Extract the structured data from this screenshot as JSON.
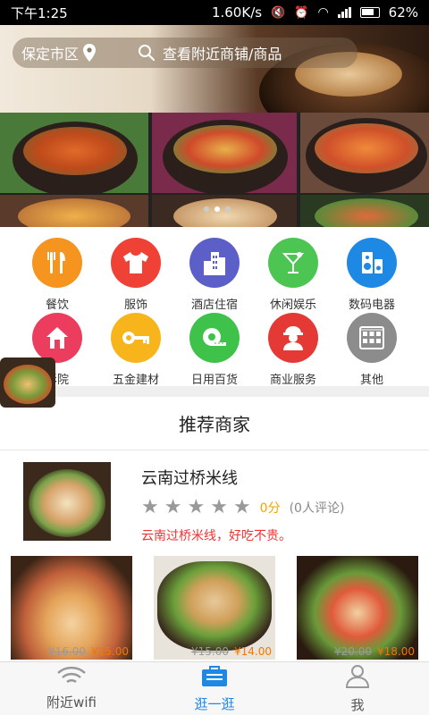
{
  "status_bar": {
    "time": "下午1:25",
    "network_speed": "1.60K/s",
    "battery": "62%"
  },
  "search": {
    "location": "保定市区",
    "placeholder": "查看附近商铺/商品",
    "location_icon": "location-pin-icon",
    "search_icon": "magnifier-icon"
  },
  "carousel": {
    "page_count": 3,
    "active_page": 1
  },
  "categories": [
    {
      "label": "餐饮",
      "icon": "fork-knife-icon",
      "color": "#f5941e"
    },
    {
      "label": "服饰",
      "icon": "shirt-icon",
      "color": "#ef4135"
    },
    {
      "label": "酒店住宿",
      "icon": "building-icon",
      "color": "#5b5fc7"
    },
    {
      "label": "休闲娱乐",
      "icon": "cocktail-icon",
      "color": "#4cc552"
    },
    {
      "label": "数码电器",
      "icon": "speaker-icon",
      "color": "#1e88e5"
    },
    {
      "label": "影院",
      "icon": "house-icon",
      "color": "#ec3d5e"
    },
    {
      "label": "五金建材",
      "icon": "key-icon",
      "color": "#f7b51b"
    },
    {
      "label": "日用百货",
      "icon": "tape-measure-icon",
      "color": "#3ec24a"
    },
    {
      "label": "商业服务",
      "icon": "person-icon",
      "color": "#e53935"
    },
    {
      "label": "其他",
      "icon": "grid-icon",
      "color": "#8c8c8c"
    }
  ],
  "recommended": {
    "title": "推荐商家"
  },
  "merchant": {
    "name": "云南过桥米线",
    "rating": 0,
    "score_text": "0分",
    "reviews_text": "(0人评论)",
    "description": "云南过桥米线，好吃不贵。"
  },
  "products": [
    {
      "old_price": "¥16.00",
      "new_price": "¥15.00"
    },
    {
      "old_price": "¥15.00",
      "new_price": "¥14.00"
    },
    {
      "old_price": "¥20.00",
      "new_price": "¥18.00"
    }
  ],
  "tabs": [
    {
      "label": "附近wifi",
      "icon": "wifi-icon",
      "active": false
    },
    {
      "label": "逛一逛",
      "icon": "shopping-bag-icon",
      "active": true
    },
    {
      "label": "我",
      "icon": "person-outline-icon",
      "active": false
    }
  ],
  "colors": {
    "accent": "#1e88e5",
    "price": "#f07800",
    "description": "#e33333",
    "score": "#f7a200"
  }
}
